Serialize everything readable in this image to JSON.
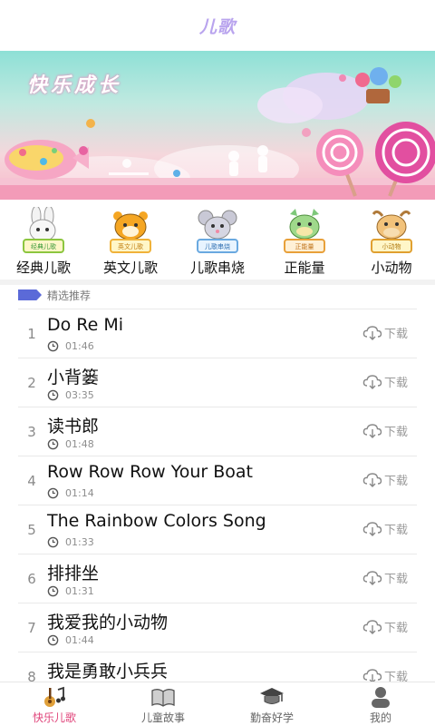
{
  "header": {
    "title": "儿歌"
  },
  "banner": {
    "title": "快乐成长"
  },
  "categories": [
    {
      "label": "经典儿歌",
      "badge": "经典儿歌",
      "icon": "rabbit-icon"
    },
    {
      "label": "英文儿歌",
      "badge": "英文儿歌",
      "icon": "tiger-icon"
    },
    {
      "label": "儿歌串烧",
      "badge": "儿歌串烧",
      "icon": "mouse-icon"
    },
    {
      "label": "正能量",
      "badge": "正能量",
      "icon": "dragon-icon"
    },
    {
      "label": "小动物",
      "badge": "小动物",
      "icon": "ox-icon"
    }
  ],
  "section": {
    "title": "精选推荐"
  },
  "songs": [
    {
      "index": "1",
      "title": "Do Re Mi",
      "duration": "01:46",
      "download": "下载"
    },
    {
      "index": "2",
      "title": "小背篓",
      "duration": "03:35",
      "download": "下载"
    },
    {
      "index": "3",
      "title": "读书郎",
      "duration": "01:48",
      "download": "下载"
    },
    {
      "index": "4",
      "title": "Row Row Row Your Boat",
      "duration": "01:14",
      "download": "下载"
    },
    {
      "index": "5",
      "title": "The Rainbow Colors Song",
      "duration": "01:33",
      "download": "下载"
    },
    {
      "index": "6",
      "title": "排排坐",
      "duration": "01:31",
      "download": "下载"
    },
    {
      "index": "7",
      "title": "我爱我的小动物",
      "duration": "01:44",
      "download": "下载"
    },
    {
      "index": "8",
      "title": "我是勇敢小兵兵",
      "duration": "",
      "download": "下载"
    }
  ],
  "tabs": [
    {
      "label": "快乐儿歌",
      "icon": "guitar-note-icon",
      "active": true
    },
    {
      "label": "儿童故事",
      "icon": "book-icon",
      "active": false
    },
    {
      "label": "勤奋好学",
      "icon": "graduation-cap-icon",
      "active": false
    },
    {
      "label": "我的",
      "icon": "person-icon",
      "active": false
    }
  ],
  "colors": {
    "accent": "#e0457b",
    "title": "#b9a4ee",
    "section_flag": "#5b6ad8"
  }
}
